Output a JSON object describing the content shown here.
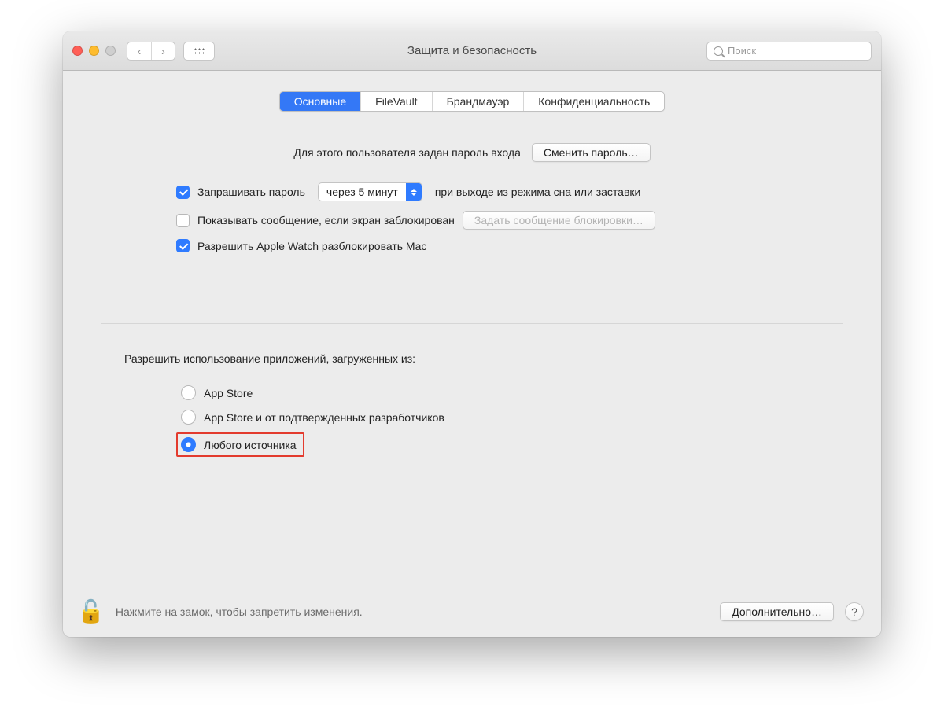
{
  "window": {
    "title": "Защита и безопасность",
    "search_placeholder": "Поиск"
  },
  "tabs": {
    "items": [
      {
        "label": "Основные",
        "active": true
      },
      {
        "label": "FileVault",
        "active": false
      },
      {
        "label": "Брандмауэр",
        "active": false
      },
      {
        "label": "Конфиденциальность",
        "active": false
      }
    ]
  },
  "general": {
    "password_set_label": "Для этого пользователя задан пароль входа",
    "change_password_btn": "Сменить пароль…",
    "require_password": {
      "checked": true,
      "label_before": "Запрашивать пароль",
      "dropdown_value": "через 5 минут",
      "label_after": "при выходе из режима сна или заставки"
    },
    "show_message": {
      "checked": false,
      "label": "Показывать сообщение, если экран заблокирован",
      "set_message_btn": "Задать сообщение блокировки…"
    },
    "apple_watch": {
      "checked": true,
      "label": "Разрешить Apple Watch разблокировать Mac"
    }
  },
  "allow_apps": {
    "title": "Разрешить использование приложений, загруженных из:",
    "options": [
      {
        "label": "App Store",
        "selected": false
      },
      {
        "label": "App Store и от подтвержденных разработчиков",
        "selected": false
      },
      {
        "label": "Любого источника",
        "selected": true,
        "highlight": true
      }
    ]
  },
  "footer": {
    "lock_text": "Нажмите на замок, чтобы запретить изменения.",
    "advanced_btn": "Дополнительно…",
    "help": "?"
  }
}
